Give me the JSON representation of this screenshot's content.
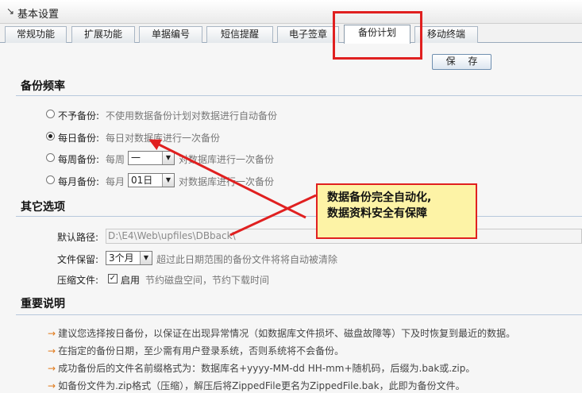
{
  "window": {
    "title": "基本设置"
  },
  "tabs": [
    {
      "label": "常规功能"
    },
    {
      "label": "扩展功能"
    },
    {
      "label": "单据编号"
    },
    {
      "label": "短信提醒"
    },
    {
      "label": "电子签章"
    },
    {
      "label": "备份计划"
    },
    {
      "label": "移动终端"
    }
  ],
  "active_tab": "备份计划",
  "toolbar": {
    "save_label": "保 存"
  },
  "backup_frequency": {
    "title": "备份频率",
    "options": [
      {
        "label": "不予备份:",
        "desc": "不使用数据备份计划对数据进行自动备份",
        "checked": false
      },
      {
        "label": "每日备份:",
        "desc": "每日对数据库进行一次备份",
        "checked": true
      },
      {
        "label": "每周备份:",
        "prefix": "每周",
        "select_value": "一",
        "suffix": "对数据库进行一次备份",
        "checked": false
      },
      {
        "label": "每月备份:",
        "prefix": "每月",
        "select_value": "01日",
        "suffix": "对数据库进行一次备份",
        "checked": false
      }
    ]
  },
  "other_options": {
    "title": "其它选项",
    "default_path_label": "默认路径:",
    "default_path_value": "D:\\E4\\Web\\upfiles\\DBback\\",
    "retention_label": "文件保留:",
    "retention_value": "3个月",
    "retention_desc": "超过此日期范围的备份文件将将自动被清除",
    "compress_label": "压缩文件:",
    "compress_checked": true,
    "compress_enable": "启用",
    "compress_desc": "节约磁盘空间，节约下载时间"
  },
  "important_notes": {
    "title": "重要说明",
    "items": [
      "建议您选择按日备份，以保证在出现异常情况（如数据库文件损坏、磁盘故障等）下及时恢复到最近的数据。",
      "在指定的备份日期，至少需有用户登录系统，否则系统将不会备份。",
      "成功备份后的文件名前缀格式为：数据库名+yyyy-MM-dd HH-mm+随机码，后缀为.bak或.zip。",
      "如备份文件为.zip格式（压缩），解压后将ZippedFile更名为ZippedFile.bak，此即为备份文件。"
    ]
  },
  "callout": {
    "line1": "数据备份完全自动化,",
    "line2": "数据资料安全有保障"
  },
  "colors": {
    "annotation_red": "#e02020",
    "callout_bg": "#fdf3a6",
    "note_arrow": "#e07a1a"
  }
}
